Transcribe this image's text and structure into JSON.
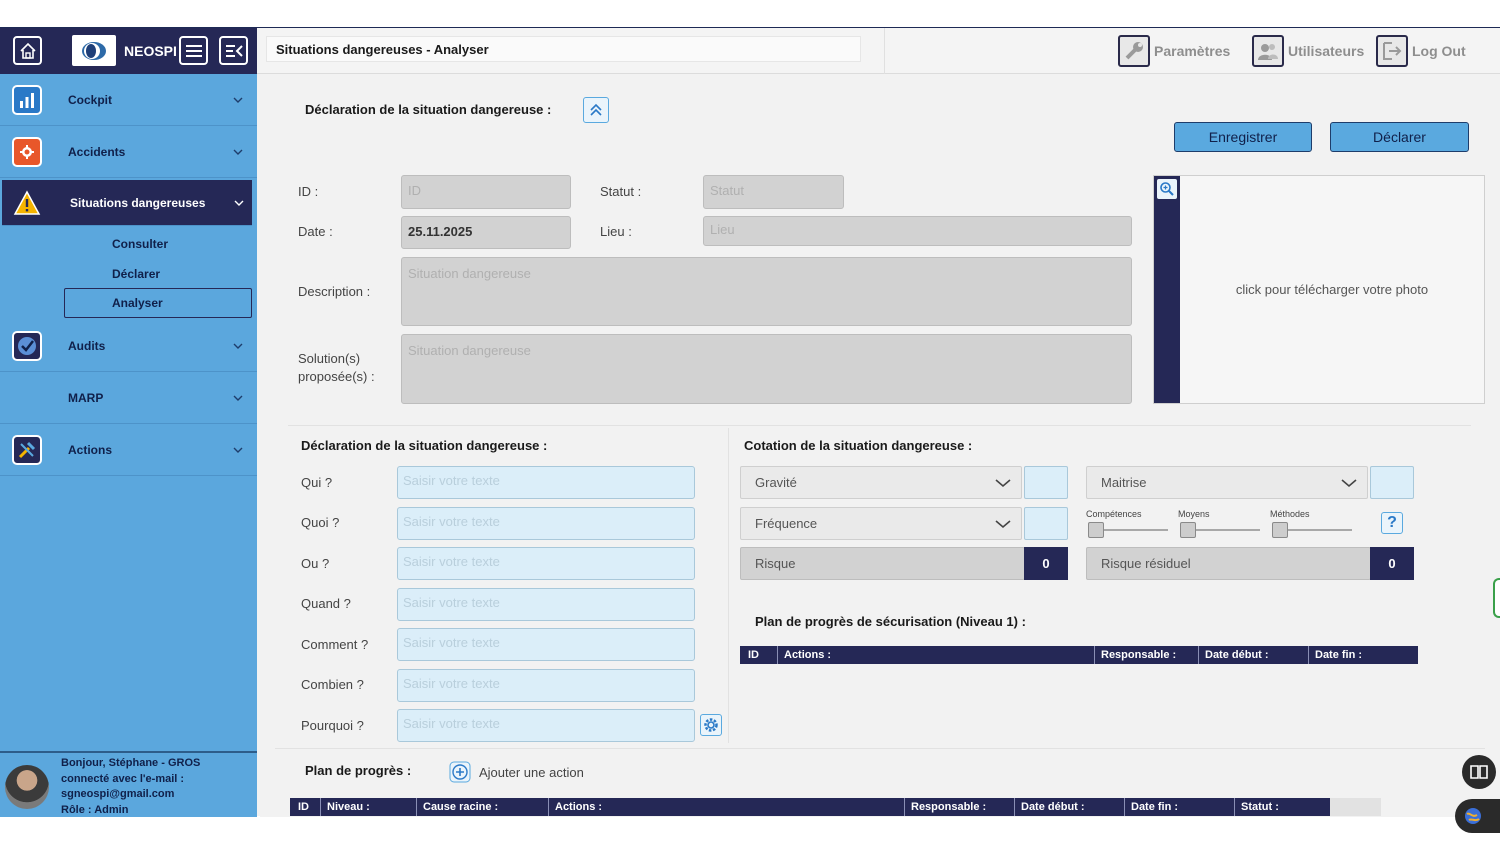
{
  "sidebar": {
    "brand": "NEOSPI",
    "items": [
      {
        "label": "Cockpit",
        "icon": "chart-icon"
      },
      {
        "label": "Accidents",
        "icon": "accident-icon"
      },
      {
        "label": "Situations dangereuses",
        "icon": "warning-icon"
      },
      {
        "label": "Audits",
        "icon": "badge-check-icon"
      },
      {
        "label": "MARP",
        "icon": ""
      },
      {
        "label": "Actions",
        "icon": "tools-icon"
      }
    ],
    "subitems": [
      "Consulter",
      "Déclarer",
      "Analyser"
    ],
    "user": {
      "greeting": "Bonjour, Stéphane - GROS",
      "email_label": "connecté avec l'e-mail :",
      "email": "sgneospi@gmail.com",
      "role": "Rôle : Admin"
    }
  },
  "header": {
    "title": "Situations dangereuses - Analyser",
    "params": "Paramètres",
    "users": "Utilisateurs",
    "logout": "Log Out"
  },
  "form": {
    "section_title": "Déclaration de la situation dangereuse :",
    "save": "Enregistrer",
    "declare": "Déclarer",
    "id_label": "ID :",
    "id_placeholder": "ID",
    "status_label": "Statut :",
    "status_placeholder": "Statut",
    "date_label": "Date :",
    "date_value": "25.11.2025",
    "place_label": "Lieu :",
    "place_placeholder": "Lieu",
    "description_label": "Description :",
    "description_placeholder": "Situation dangereuse",
    "solution_label_1": "Solution(s)",
    "solution_label_2": "proposée(s) :",
    "solution_placeholder": "Situation dangereuse",
    "photo_text": "click pour télécharger votre photo"
  },
  "qqoqccp": {
    "title": "Déclaration de la situation dangereuse :",
    "placeholder": "Saisir votre texte",
    "questions": [
      "Qui ?",
      "Quoi ?",
      "Ou ?",
      "Quand ?",
      "Comment ?",
      "Combien ?",
      "Pourquoi ?"
    ]
  },
  "cotation": {
    "title": "Cotation de la situation dangereuse :",
    "gravite": "Gravité",
    "frequence": "Fréquence",
    "maitrise": "Maitrise",
    "risque": "Risque",
    "risque_value": "0",
    "risque_residuel": "Risque résiduel",
    "risque_residuel_value": "0",
    "sliders": [
      "Compétences",
      "Moyens",
      "Méthodes"
    ],
    "help": "?",
    "plan_title": "Plan de progrès de sécurisation (Niveau 1) :",
    "plan_columns": [
      "ID",
      "Actions :",
      "Responsable :",
      "Date début :",
      "Date fin :"
    ]
  },
  "plan": {
    "title": "Plan de progrès :",
    "add_action": "Ajouter une action",
    "columns": [
      "ID",
      "Niveau :",
      "Cause racine :",
      "Actions :",
      "Responsable :",
      "Date début :",
      "Date fin :",
      "Statut :"
    ]
  }
}
